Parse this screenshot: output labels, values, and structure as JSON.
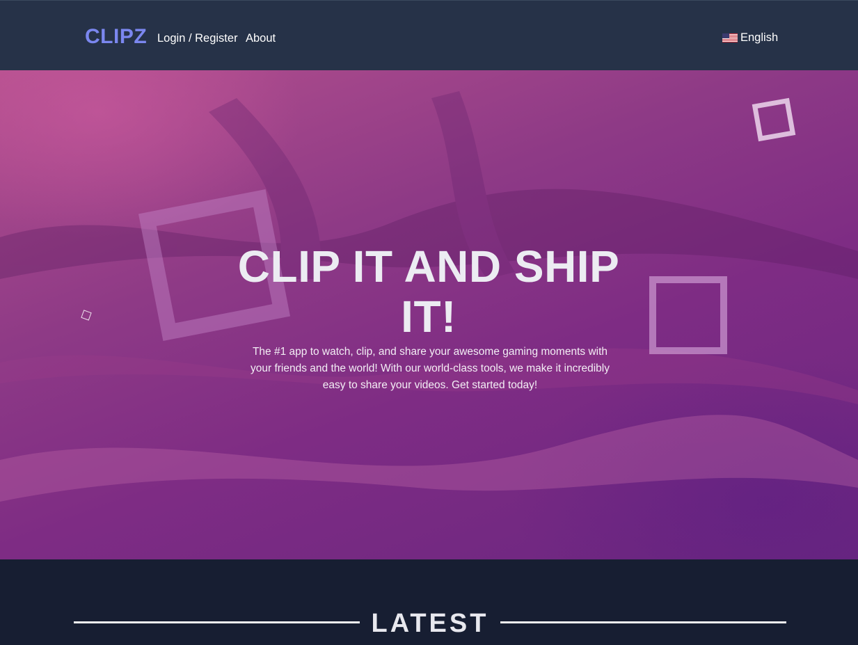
{
  "navbar": {
    "brand": "CLIPZ",
    "links": [
      "Login / Register",
      "About"
    ],
    "language": {
      "label": "English",
      "flag_icon": "us-flag-icon"
    }
  },
  "hero": {
    "title": "CLIP IT AND SHIP IT!",
    "description": "The #1 app to watch, clip, and share your awesome gaming moments with your friends and the world! With our world-class tools, we make it incredibly easy to share your videos. Get started today!"
  },
  "section": {
    "title": "LATEST"
  },
  "colors": {
    "navbar_bg": "#263248",
    "page_bg": "#171e32",
    "brand": "#7b87ef",
    "hero_pink": "#b4508e",
    "hero_purple": "#6a2680"
  }
}
